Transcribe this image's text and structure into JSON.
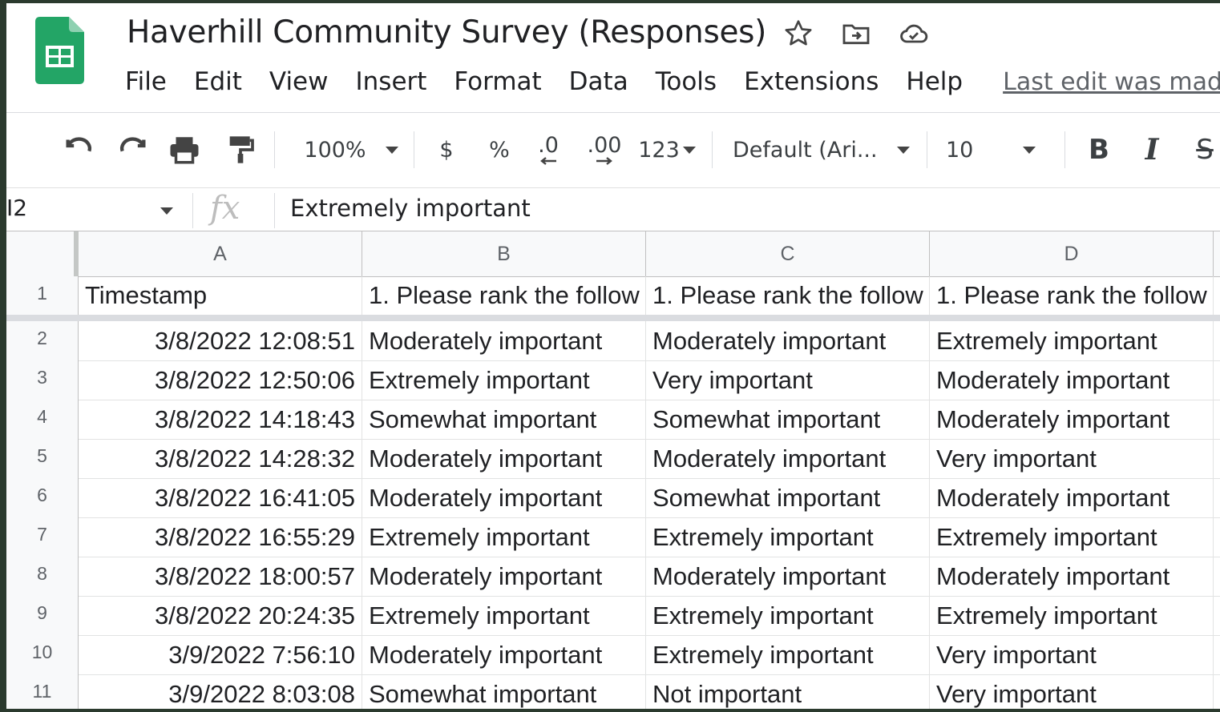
{
  "app": {
    "title": "Haverhill Community Survey (Responses)",
    "icons": [
      "star-icon",
      "move-to-folder-icon",
      "cloud-status-icon"
    ],
    "brand_color": "#23a566"
  },
  "menu": {
    "items": [
      "File",
      "Edit",
      "View",
      "Insert",
      "Format",
      "Data",
      "Tools",
      "Extensions",
      "Help"
    ],
    "last_edit": "Last edit was made"
  },
  "toolbar": {
    "zoom": "100%",
    "currency": "$",
    "percent": "%",
    "decrease_decimal": ".0",
    "increase_decimal": ".00",
    "more_formats": "123",
    "font": "Default (Ari...",
    "font_size": "10",
    "bold": "B",
    "italic": "I",
    "strikethrough": "S"
  },
  "formula_bar": {
    "cell_ref": "I2",
    "fx": "fx",
    "value": "Extremely important"
  },
  "sheet": {
    "columns": [
      "A",
      "B",
      "C",
      "D"
    ],
    "rows": [
      {
        "n": "1",
        "a": "Timestamp",
        "b": "1.  Please rank the follow",
        "c": "1.  Please rank the follow",
        "d": "1.  Please rank the follow"
      },
      {
        "n": "2",
        "a": "3/8/2022 12:08:51",
        "b": "Moderately important",
        "c": "Moderately important",
        "d": "Extremely important"
      },
      {
        "n": "3",
        "a": "3/8/2022 12:50:06",
        "b": "Extremely important",
        "c": "Very important",
        "d": "Moderately important"
      },
      {
        "n": "4",
        "a": "3/8/2022 14:18:43",
        "b": "Somewhat important",
        "c": "Somewhat important",
        "d": "Moderately important"
      },
      {
        "n": "5",
        "a": "3/8/2022 14:28:32",
        "b": "Moderately important",
        "c": "Moderately important",
        "d": "Very important"
      },
      {
        "n": "6",
        "a": "3/8/2022 16:41:05",
        "b": "Moderately important",
        "c": "Somewhat important",
        "d": "Moderately important"
      },
      {
        "n": "7",
        "a": "3/8/2022 16:55:29",
        "b": "Extremely important",
        "c": "Extremely important",
        "d": "Extremely important"
      },
      {
        "n": "8",
        "a": "3/8/2022 18:00:57",
        "b": "Moderately important",
        "c": "Moderately important",
        "d": "Moderately important"
      },
      {
        "n": "9",
        "a": "3/8/2022 20:24:35",
        "b": "Extremely important",
        "c": "Extremely important",
        "d": "Extremely important"
      },
      {
        "n": "10",
        "a": "3/9/2022 7:56:10",
        "b": "Moderately important",
        "c": "Extremely important",
        "d": "Very important"
      },
      {
        "n": "11",
        "a": "3/9/2022 8:03:08",
        "b": "Somewhat important",
        "c": "Not important",
        "d": "Very important"
      }
    ]
  }
}
